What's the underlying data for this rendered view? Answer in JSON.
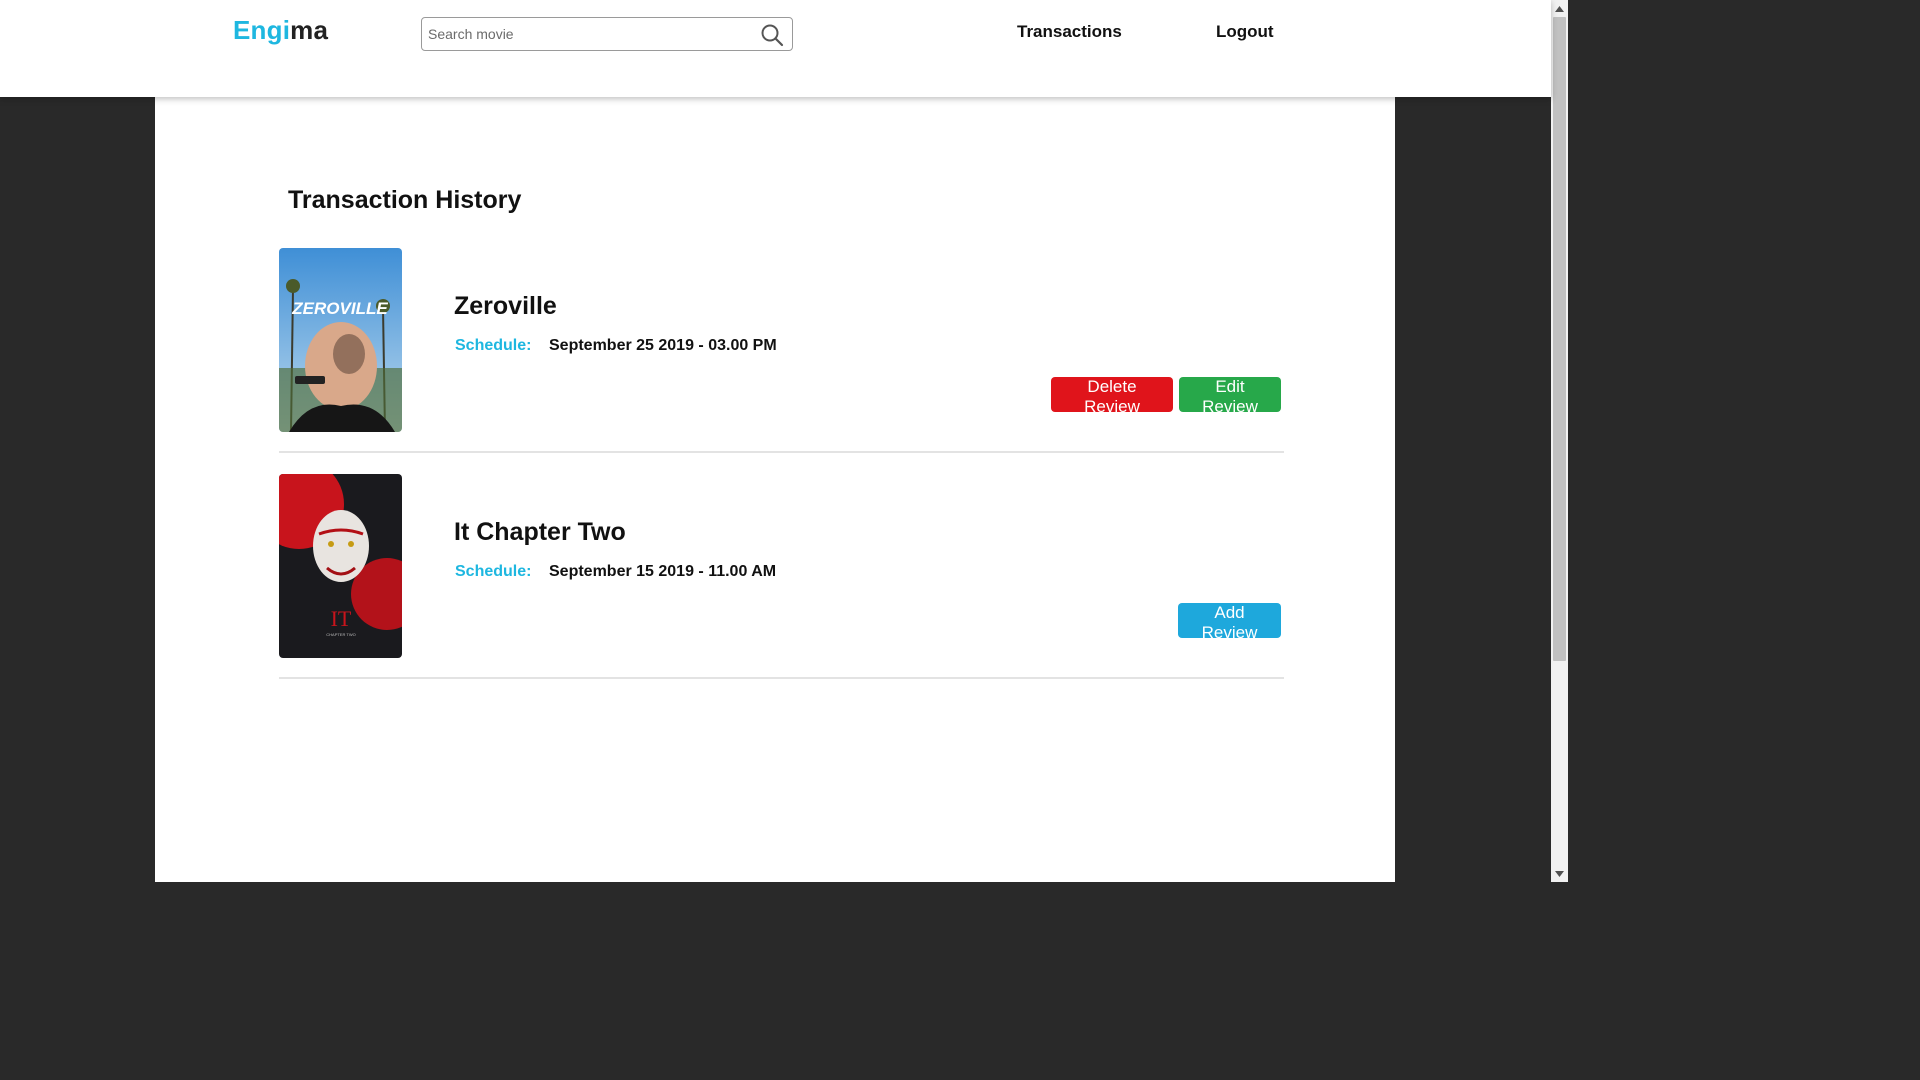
{
  "header": {
    "logo_part1": "Engi",
    "logo_part2": "ma",
    "search_placeholder": "Search movie",
    "nav": {
      "transactions": "Transactions",
      "logout": "Logout"
    }
  },
  "main": {
    "heading": "Transaction History",
    "transactions": [
      {
        "title": "Zeroville",
        "poster_text": "ZEROVILLE",
        "schedule_label": "Schedule:",
        "schedule_value": "September 25 2019 - 03.00 PM",
        "buttons": {
          "delete": "Delete Review",
          "edit": "Edit Review"
        }
      },
      {
        "title": "It Chapter Two",
        "poster_text": "IT",
        "poster_subtext": "CHAPTER TWO",
        "schedule_label": "Schedule:",
        "schedule_value": "September 15 2019 - 11.00 AM",
        "buttons": {
          "add": "Add Review"
        }
      }
    ]
  },
  "colors": {
    "accent": "#1eb7e0",
    "delete": "#e0141b",
    "edit": "#27a84a",
    "add": "#1ea8dc",
    "page_bg": "#292929"
  },
  "icons": {
    "search": "search-icon",
    "scroll_up": "arrow-up-icon",
    "scroll_down": "arrow-down-icon"
  }
}
